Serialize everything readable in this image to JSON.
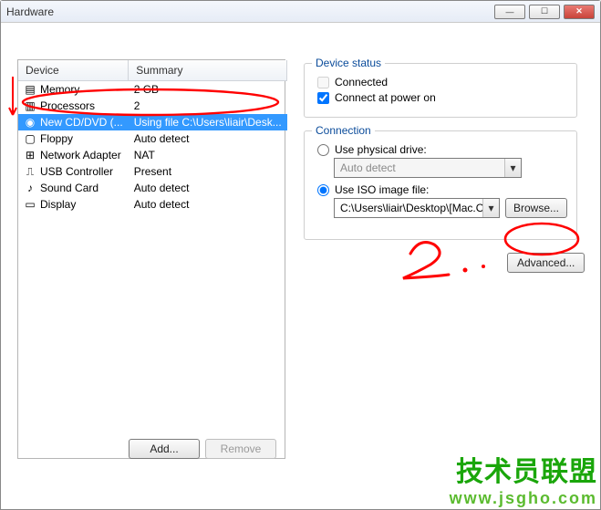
{
  "window": {
    "title": "Hardware"
  },
  "deviceList": {
    "headers": {
      "device": "Device",
      "summary": "Summary"
    },
    "rows": [
      {
        "icon": "memory-icon",
        "device": "Memory",
        "summary": "2 GB"
      },
      {
        "icon": "cpu-icon",
        "device": "Processors",
        "summary": "2"
      },
      {
        "icon": "cd-icon",
        "device": "New CD/DVD (...",
        "summary": "Using file C:\\Users\\liair\\Desk...",
        "selected": true
      },
      {
        "icon": "floppy-icon",
        "device": "Floppy",
        "summary": "Auto detect"
      },
      {
        "icon": "nic-icon",
        "device": "Network Adapter",
        "summary": "NAT"
      },
      {
        "icon": "usb-icon",
        "device": "USB Controller",
        "summary": "Present"
      },
      {
        "icon": "sound-icon",
        "device": "Sound Card",
        "summary": "Auto detect"
      },
      {
        "icon": "display-icon",
        "device": "Display",
        "summary": "Auto detect"
      }
    ],
    "buttons": {
      "add": "Add...",
      "remove": "Remove"
    }
  },
  "status": {
    "legend": "Device status",
    "connected_label": "Connected",
    "connected_checked": false,
    "poweron_label": "Connect at power on",
    "poweron_checked": true
  },
  "connection": {
    "legend": "Connection",
    "physical_label": "Use physical drive:",
    "physical_selected": false,
    "physical_value": "Auto detect",
    "iso_label": "Use ISO image file:",
    "iso_selected": true,
    "iso_value": "C:\\Users\\liair\\Desktop\\[Mac.OS.",
    "browse": "Browse..."
  },
  "advanced": {
    "label": "Advanced..."
  },
  "annotation": {
    "number": "2."
  },
  "watermark": {
    "line1": "技术员联盟",
    "line2": "www.jsgho.com"
  }
}
